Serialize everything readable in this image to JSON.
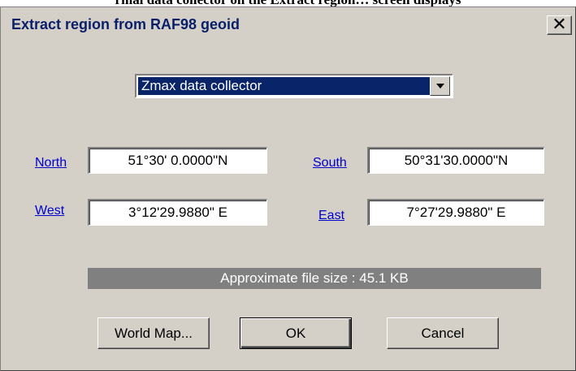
{
  "document": {
    "caption": "rmal data collector on the Extract region… screen displays"
  },
  "dialog": {
    "title": "Extract region from RAF98 geoid",
    "close_label": "✕"
  },
  "collector": {
    "selected": "Zmax data collector"
  },
  "coordinates": {
    "north": {
      "label": "North",
      "value": "51°30'  0.0000\"N"
    },
    "south": {
      "label": "South",
      "value": "50°31'30.0000\"N"
    },
    "west": {
      "label": "West",
      "value": "3°12'29.9880\" E"
    },
    "east": {
      "label": "East",
      "value": "7°27'29.9880\" E"
    }
  },
  "file_size": {
    "text": "Approximate file size : 45.1 KB"
  },
  "buttons": {
    "world_map": "World Map...",
    "ok": "OK",
    "cancel": "Cancel"
  },
  "colors": {
    "dialog_bg": "#d4d0c8",
    "selection": "#0a246a",
    "title_text": "#0a1f6a",
    "link": "#0000cc",
    "status_bar": "#808080"
  }
}
